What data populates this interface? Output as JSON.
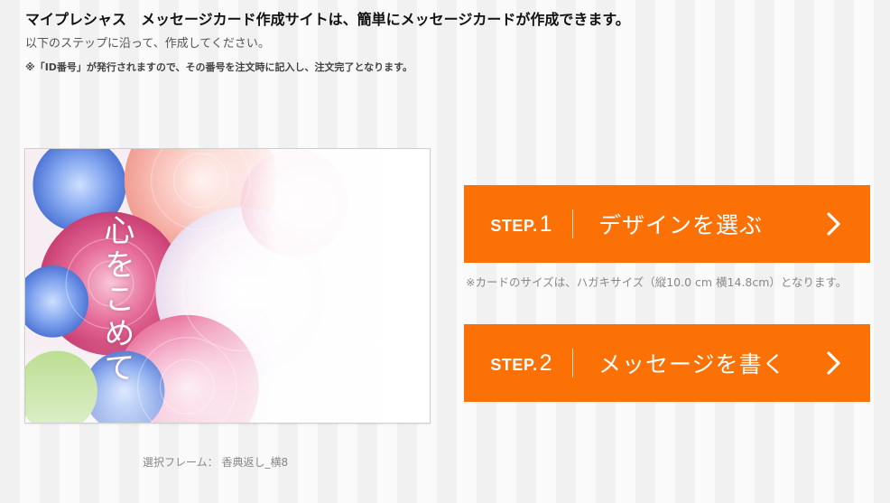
{
  "intro": {
    "headline": "マイプレシャス　メッセージカード作成サイトは、簡単にメッセージカードが作成できます。",
    "subline": "以下のステップに沿って、作成してください。",
    "note": "※「ID番号」が発行されますので、その番号を注文時に記入し、注文完了となります。"
  },
  "card": {
    "calligraphy_text": "心をこめて",
    "frame_label": "選択フレーム： 香典返し_横8"
  },
  "steps": [
    {
      "prefix": "STEP.",
      "number": "1",
      "label": "デザインを選ぶ"
    },
    {
      "prefix": "STEP.",
      "number": "2",
      "label": "メッセージを書く"
    }
  ],
  "size_note": "※カードのサイズは、ハガキサイズ（縦10.0 cm 横14.8cm）となります。",
  "colors": {
    "accent": "#fb7105"
  },
  "icons": {
    "step_arrow": "chevron-right-icon"
  }
}
